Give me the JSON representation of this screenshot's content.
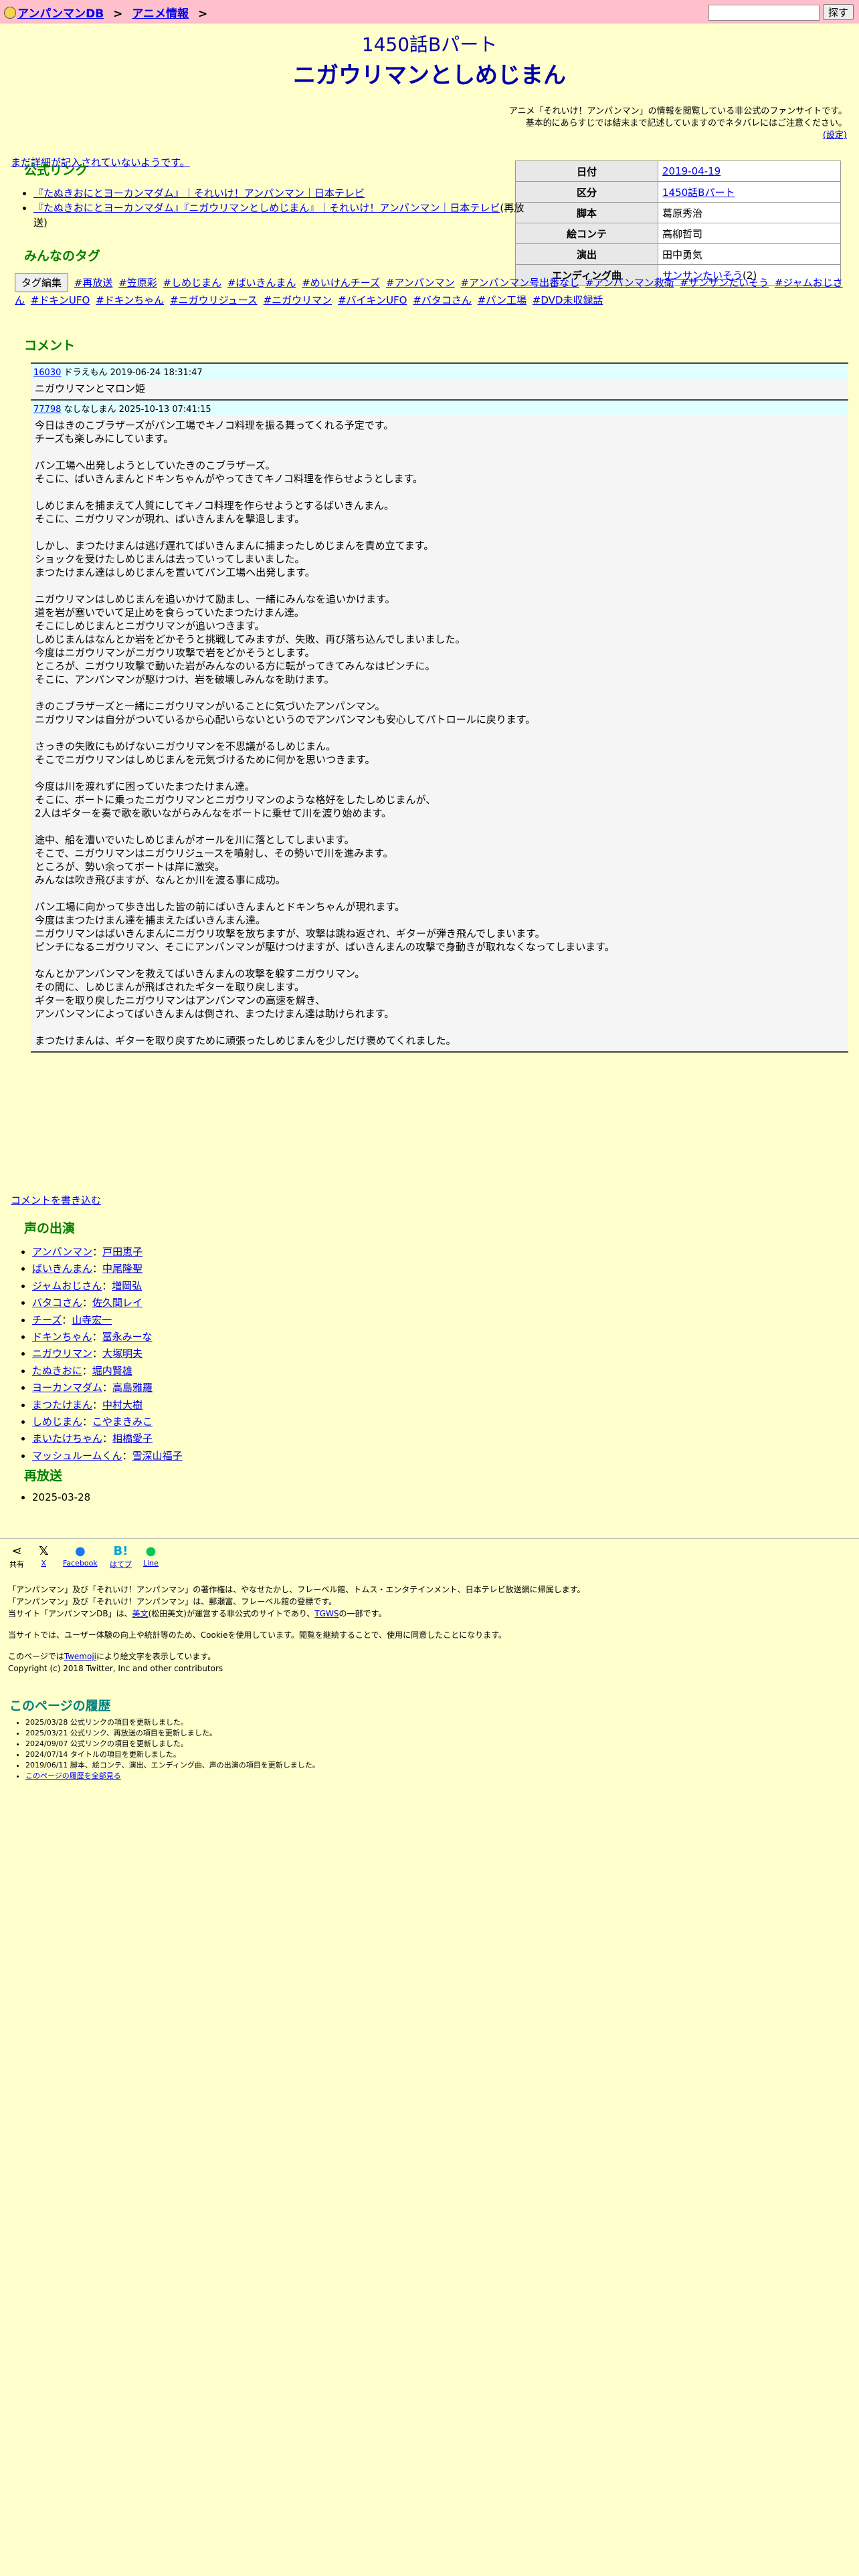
{
  "breadcrumb": {
    "home": "アンパンマンDB",
    "sep1": ">",
    "section": "アニメ情報",
    "sep2": ">"
  },
  "search": {
    "button": "探す",
    "placeholder": ""
  },
  "episode": {
    "number_title": "1450話Bパート",
    "title": "ニガウリマンとしめじまん"
  },
  "notice": {
    "line1": "アニメ「それいけ！アンパンマン」の情報を閲覧している非公式のファンサイトです。",
    "line2": "基本的にあらすじでは結末まで記述していますのでネタバレにはご注意ください。",
    "settings": "(設定)"
  },
  "undescribed": "まだ詳細が記入されていないようです。",
  "info": {
    "rows": [
      {
        "label": "日付",
        "value": "2019-04-19",
        "link": true
      },
      {
        "label": "区分",
        "value": "1450話Bパート",
        "link": true
      },
      {
        "label": "脚本",
        "value": "葛原秀治",
        "link": false
      },
      {
        "label": "絵コンテ",
        "value": "高柳哲司",
        "link": false
      },
      {
        "label": "演出",
        "value": "田中勇気",
        "link": false
      },
      {
        "label": "エンディング曲",
        "value": "サンサンたいそう",
        "suffix": "(2)",
        "link": true
      }
    ]
  },
  "official_links": {
    "heading": "公式リンク",
    "items": [
      {
        "text": "『たぬきおにとヨーカンマダム』｜それいけ！アンパンマン｜日本テレビ",
        "suffix": ""
      },
      {
        "text": "『たぬきおにとヨーカンマダム』『ニガウリマンとしめじまん』｜それいけ！アンパンマン｜日本テレビ",
        "suffix": "(再放送)"
      }
    ]
  },
  "tags": {
    "heading": "みんなのタグ",
    "edit_button": "タグ編集",
    "items": [
      "#再放送",
      "#笠原彩",
      "#しめじまん",
      "#ばいきんまん",
      "#めいけんチーズ",
      "#アンパンマン",
      "#アンパンマン号出番なし",
      "#アンパンマン救衛",
      "#サンサンたいそう",
      "#ジャムおじさん",
      "#ドキンUFO",
      "#ドキンちゃん",
      "#ニガウリジュース",
      "#ニガウリマン",
      "#バイキンUFO",
      "#バタコさん",
      "#パン工場",
      "#DVD未収録話"
    ]
  },
  "comments": {
    "heading": "コメント",
    "items": [
      {
        "id": "16030",
        "meta": "ドラえもん 2019-06-24 18:31:47",
        "body": "ニガウリマンとマロン姫"
      },
      {
        "id": "77798",
        "meta": "なしなしまん 2025-10-13 07:41:15",
        "body": "今日はきのこブラザーズがパン工場でキノコ料理を振る舞ってくれる予定です。\nチーズも楽しみにしています。\n\nパン工場へ出発しようとしていたきのこブラザーズ。\nそこに、ばいきんまんとドキンちゃんがやってきてキノコ料理を作らせようとします。\n\nしめじまんを捕まえて人質にしてキノコ料理を作らせようとするばいきんまん。\nそこに、ニガウリマンが現れ、ばいきんまんを撃退します。\n\nしかし、まつたけまんは逃げ遅れてばいきんまんに捕まったしめじまんを責め立てます。\nショックを受けたしめじまんは去っていってしまいました。\nまつたけまん達はしめじまんを置いてパン工場へ出発します。\n\nニガウリマンはしめじまんを追いかけて励まし、一緒にみんなを追いかけます。\n道を岩が塞いでいて足止めを食らっていたまつたけまん達。\nそこにしめじまんとニガウリマンが追いつきます。\nしめじまんはなんとか岩をどかそうと挑戦してみますが、失敗、再び落ち込んでしまいました。\n今度はニガウリマンがニガウリ攻撃で岩をどかそうとします。\nところが、ニガウリ攻撃で動いた岩がみんなのいる方に転がってきてみんなはピンチに。\nそこに、アンパンマンが駆けつけ、岩を破壊しみんなを助けます。\n\nきのこブラザーズと一緒にニガウリマンがいることに気づいたアンパンマン。\nニガウリマンは自分がついているから心配いらないというのでアンパンマンも安心してパトロールに戻ります。\n\nさっきの失敗にもめげないニガウリマンを不思議がるしめじまん。\nそこでニガウリマンはしめじまんを元気づけるために何かを思いつきます。\n\n今度は川を渡れずに困っていたまつたけまん達。\nそこに、ボートに乗ったニガウリマンとニガウリマンのような格好をしたしめじまんが、\n2人はギターを奏で歌を歌いながらみんなをボートに乗せて川を渡り始めます。\n\n途中、船を漕いでいたしめじまんがオールを川に落としてしまいます。\nそこで、ニガウリマンはニガウリジュースを噴射し、その勢いで川を進みます。\nところが、勢い余ってボートは岸に激突。\nみんなは吹き飛びますが、なんとか川を渡る事に成功。\n\nパン工場に向かって歩き出した皆の前にばいきんまんとドキンちゃんが現れます。\n今度はまつたけまん達を捕まえたばいきんまん達。\nニガウリマンはばいきんまんにニガウリ攻撃を放ちますが、攻撃は跳ね返され、ギターが弾き飛んでしまいます。\nピンチになるニガウリマン、そこにアンパンマンが駆けつけますが、ばいきんまんの攻撃で身動きが取れなくなってしまいます。\n\nなんとかアンパンマンを救えてばいきんまんの攻撃を躱すニガウリマン。\nその間に、しめじまんが飛ばされたギターを取り戻します。\nギターを取り戻したニガウリマンはアンパンマンの高速を解き、\nアンパンマンによってばいきんまんは倒され、まつたけまん達は助けられます。\n\nまつたけまんは、ギターを取り戻すために頑張ったしめじまんを少しだけ褒めてくれました。"
      }
    ],
    "write_link": "コメントを書き込む"
  },
  "voices": {
    "heading": "声の出演",
    "items": [
      {
        "role": "アンパンマン",
        "actor": "戸田恵子"
      },
      {
        "role": "ばいきんまん",
        "actor": "中尾隆聖"
      },
      {
        "role": "ジャムおじさん",
        "actor": "増岡弘"
      },
      {
        "role": "バタコさん",
        "actor": "佐久間レイ"
      },
      {
        "role": "チーズ",
        "actor": "山寺宏一"
      },
      {
        "role": "ドキンちゃん",
        "actor": "冨永みーな"
      },
      {
        "role": "ニガウリマン",
        "actor": "大塚明夫"
      },
      {
        "role": "たぬきおに",
        "actor": "堀内賢雄"
      },
      {
        "role": "ヨーカンマダム",
        "actor": "高島雅羅"
      },
      {
        "role": "まつたけまん",
        "actor": "中村大樹"
      },
      {
        "role": "しめじまん",
        "actor": "こやまきみこ"
      },
      {
        "role": "まいたけちゃん",
        "actor": "相橋愛子"
      },
      {
        "role": "マッシュルームくん",
        "actor": "雪深山福子"
      }
    ]
  },
  "rebroadcast": {
    "heading": "再放送",
    "items": [
      "2025-03-28"
    ]
  },
  "share": [
    {
      "icon": "share-icon",
      "label": "共有"
    },
    {
      "icon": "x-icon",
      "label": "X"
    },
    {
      "icon": "facebook-icon",
      "label": "Facebook"
    },
    {
      "icon": "hatena-icon",
      "label": "はてブ"
    },
    {
      "icon": "line-icon",
      "label": "Line"
    }
  ],
  "footer": {
    "line1": "「アンパンマン」及び「それいけ！アンパンマン」の著作権は、やなせたかし、フレーベル館、トムス・エンタテインメント、日本テレビ放送網に帰属します。",
    "line2": "「アンパンマン」及び「それいけ！アンパンマン」は、郵瀬富、フレーベル館の登標です。",
    "line3a": "当サイト「アンパンマンDB」は、",
    "line3_link1": "美文",
    "line3b": "(松田美文)が運営する非公式のサイトであり、",
    "line3_link2": "TGWS",
    "line3c": "の一部です。",
    "cookie": "当サイトでは、ユーザー体験の向上や統計等のため、Cookieを使用しています。閲覧を継続することで、使用に同意したことになります。",
    "emoji_a": "このページでは",
    "emoji_link": "Twemoji",
    "emoji_b": "により絵文字を表示しています。",
    "copyright": "Copyright (c) 2018 Twitter, Inc and other contributors"
  },
  "history": {
    "heading": "このページの履歴",
    "items": [
      "2025/03/28 公式リンクの項目を更新しました。",
      "2025/03/21 公式リンク、再放送の項目を更新しました。",
      "2024/09/07 公式リンクの項目を更新しました。",
      "2024/07/14 タイトルの項目を更新しました。",
      "2019/06/11 脚本、絵コンテ、演出、エンディング曲、声の出演の項目を更新しました。"
    ],
    "all_link": "このページの履歴を全部見る"
  }
}
